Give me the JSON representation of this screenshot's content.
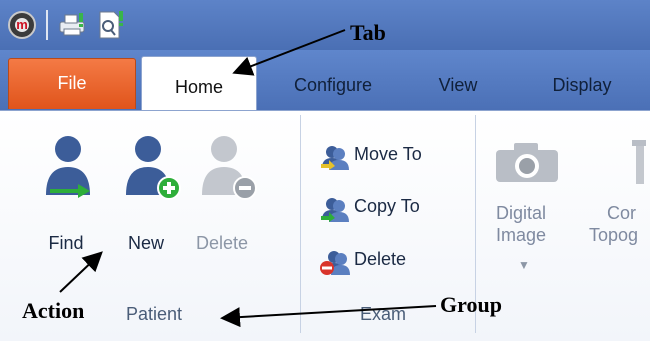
{
  "qat": {
    "logo_letter": "m",
    "icons": [
      "app-logo-icon",
      "printer-icon",
      "print-preview-icon"
    ]
  },
  "tabs": {
    "file": "File",
    "home": "Home",
    "configure": "Configure",
    "view": "View",
    "display": "Display",
    "active": "Home"
  },
  "patient_group": {
    "label": "Patient",
    "buttons": [
      {
        "label": "Find",
        "enabled": true
      },
      {
        "label": "New",
        "enabled": true
      },
      {
        "label": "Delete",
        "enabled": false
      }
    ]
  },
  "exam_group": {
    "label": "Exam",
    "buttons": [
      {
        "label": "Move To"
      },
      {
        "label": "Copy To"
      },
      {
        "label": "Delete"
      }
    ]
  },
  "acquire_group": {
    "digital_image": {
      "line1": "Digital",
      "line2": "Image",
      "enabled": false
    },
    "cutoff_button": {
      "line1": "Cor",
      "line2": "Topog",
      "enabled": false
    }
  },
  "annotations": {
    "tab": "Tab",
    "action": "Action",
    "group": "Group"
  },
  "colors": {
    "title_bar": "#4a6fb4",
    "file_tab": "#e0541b",
    "accent_green": "#2eae3a",
    "accent_red": "#d9342b"
  }
}
